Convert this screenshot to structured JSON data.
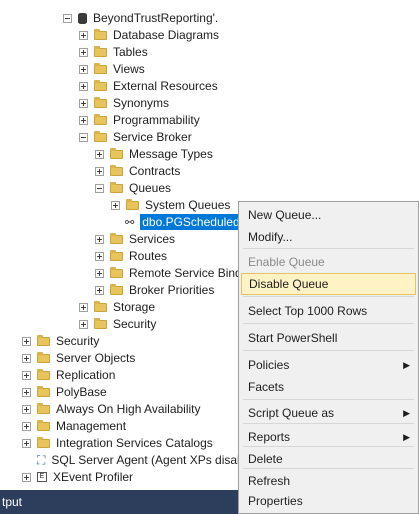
{
  "tree": {
    "database": "BeyondTrustReporting'.",
    "database_children": [
      "Database Diagrams",
      "Tables",
      "Views",
      "External Resources",
      "Synonyms",
      "Programmability"
    ],
    "service_broker": "Service Broker",
    "message_types": "Message Types",
    "contracts": "Contracts",
    "queues": "Queues",
    "system_queues": "System Queues",
    "selected_queue": "dbo.PGScheduledJobQueue",
    "services": "Services",
    "routes": "Routes",
    "remote_service_binding": "Remote Service Binding",
    "broker_priorities": "Broker Priorities",
    "storage": "Storage",
    "db_security": "Security",
    "server_nodes": [
      "Security",
      "Server Objects",
      "Replication",
      "PolyBase",
      "Always On High Availability",
      "Management",
      "Integration Services Catalogs"
    ],
    "sql_agent": "SQL Server Agent (Agent XPs disabled)",
    "xevent": "XEvent Profiler"
  },
  "bottom_bar": {
    "label": "tput"
  },
  "context_menu": {
    "new_queue": "New Queue...",
    "modify": "Modify...",
    "enable_queue": "Enable Queue",
    "disable_queue": "Disable Queue",
    "select_top": "Select Top 1000 Rows",
    "start_powershell": "Start PowerShell",
    "policies": "Policies",
    "facets": "Facets",
    "script_queue_as": "Script Queue as",
    "reports": "Reports",
    "delete": "Delete",
    "refresh": "Refresh",
    "properties": "Properties"
  },
  "colors": {
    "selection": "#0078d7",
    "hover": "#fff2c4",
    "folder": "#e8c45c",
    "status_bar": "#2d3e5c"
  },
  "icons": [
    "expand-icon",
    "collapse-icon",
    "folder-icon",
    "database-icon",
    "queue-icon",
    "agent-icon",
    "xevent-icon",
    "submenu-arrow-icon"
  ]
}
